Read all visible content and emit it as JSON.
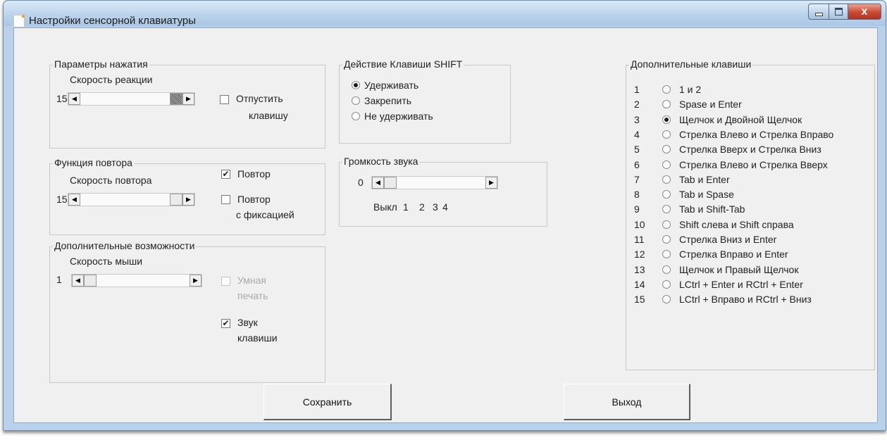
{
  "window": {
    "title": "Настройки сенсорной клавиатуры",
    "close_glyph": "x"
  },
  "press": {
    "group_title": "Параметры нажатия",
    "speed_label": "Скорость реакции",
    "speed_value": "15",
    "release_line1": "Отпустить",
    "release_line2": "клавишу",
    "release_checked": false
  },
  "repeat": {
    "group_title": "Функция повтора",
    "speed_label": "Скорость повтора",
    "speed_value": "15",
    "repeat_label": "Повтор",
    "repeat_checked": true,
    "fix_line1": "Повтор",
    "fix_line2": "с фиксацией",
    "fix_checked": false
  },
  "extra": {
    "group_title": "Дополнительные возможности",
    "mouse_label": "Скорость мыши",
    "mouse_value": "1",
    "smart_line1": "Умная",
    "smart_line2": "печать",
    "smart_enabled": false,
    "sound_line1": "Звук",
    "sound_line2": "клавиши",
    "sound_checked": true
  },
  "shift": {
    "group_title": "Действие Клавиши SHIFT",
    "options": [
      "Удерживать",
      "Закрепить",
      "Не удерживать"
    ],
    "selected": 0
  },
  "volume": {
    "group_title": "Громкость звука",
    "value": "0",
    "scale": [
      "Выкл",
      "1",
      "2",
      "3",
      "4"
    ]
  },
  "keys": {
    "group_title": "Дополнительные клавиши",
    "selected": 3,
    "items": [
      {
        "num": "1",
        "label": "1 и 2"
      },
      {
        "num": "2",
        "label": "Spase и Enter"
      },
      {
        "num": "3",
        "label": "Щелчок и Двойной Щелчок"
      },
      {
        "num": "4",
        "label": "Стрелка Влево и Стрелка Вправо"
      },
      {
        "num": "5",
        "label": "Стрелка Вверх и Стрелка Вниз"
      },
      {
        "num": "6",
        "label": "Стрелка Влево и Стрелка Вверх"
      },
      {
        "num": "7",
        "label": "Tab и Enter"
      },
      {
        "num": "8",
        "label": "Tab и Spase"
      },
      {
        "num": "9",
        "label": "Tab и Shift-Tab"
      },
      {
        "num": "10",
        "label": "Shift слева и Shift справа"
      },
      {
        "num": "11",
        "label": "Стрелка Вниз и Enter"
      },
      {
        "num": "12",
        "label": "Стрелка Вправо и Enter"
      },
      {
        "num": "13",
        "label": "Щелчок и Правый Щелчок"
      },
      {
        "num": "14",
        "label": "LCtrl + Enter и RCtrl + Enter"
      },
      {
        "num": "15",
        "label": "LCtrl + Вправо и RCtrl + Вниз"
      }
    ]
  },
  "buttons": {
    "save": "Сохранить",
    "exit": "Выход"
  },
  "icons": {
    "scroll_left": "arrow-left-icon",
    "scroll_right": "arrow-right-icon",
    "check": "checkmark-icon",
    "radio": "radio-dot-icon"
  }
}
